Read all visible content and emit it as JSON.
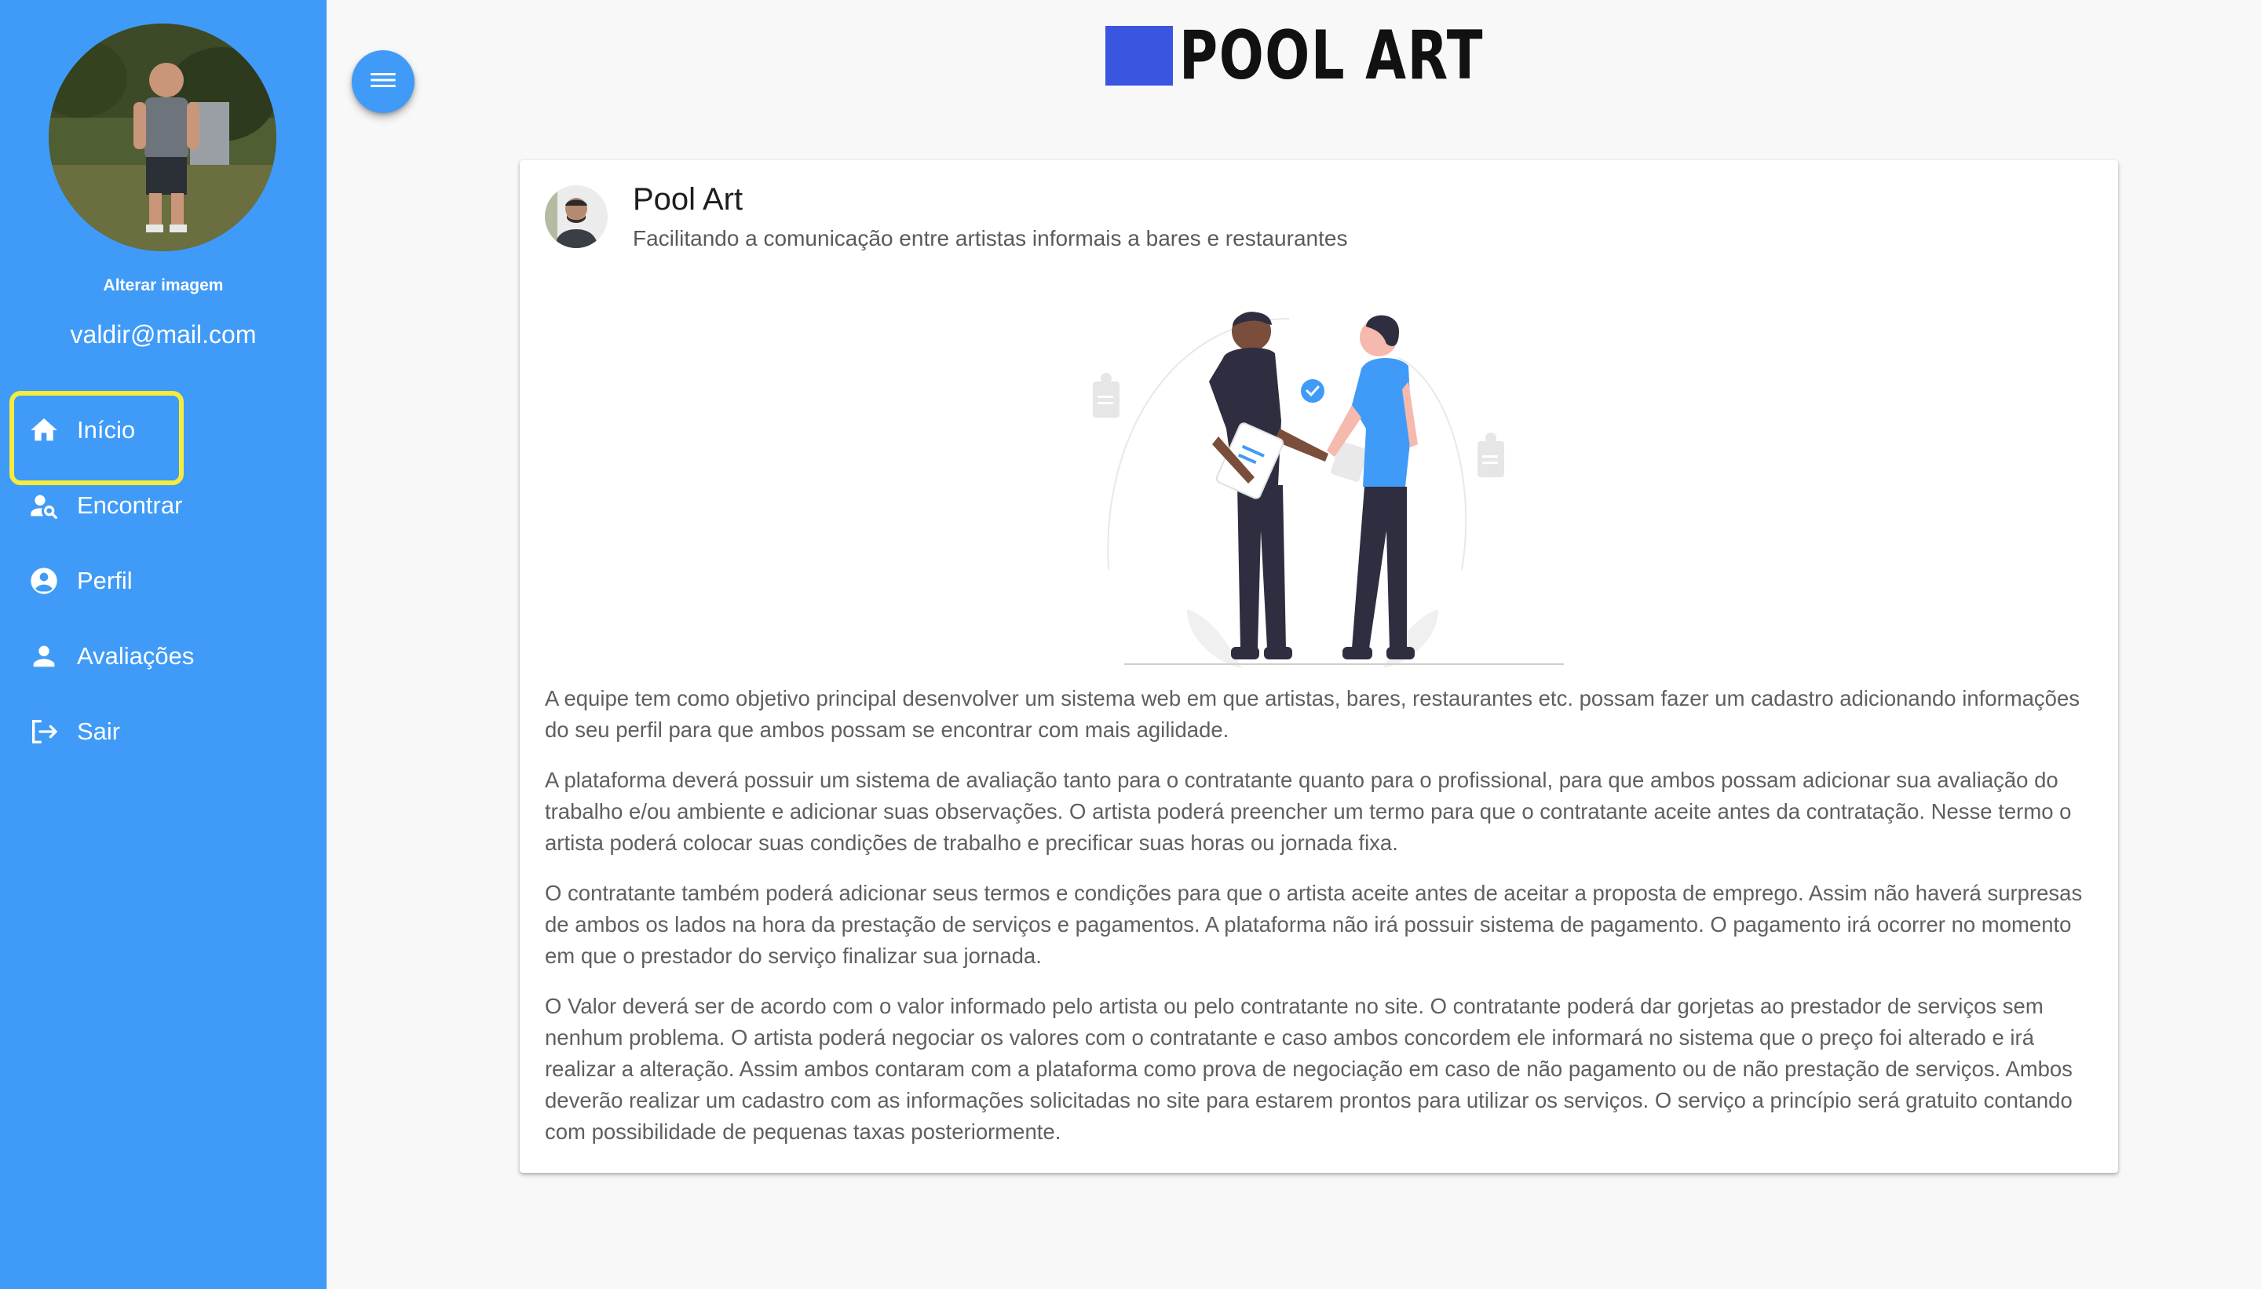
{
  "app": {
    "logo_text": "POOL ART"
  },
  "sidebar": {
    "change_image_label": "Alterar imagem",
    "email": "valdir@mail.com",
    "items": [
      {
        "label": "Início",
        "icon": "home-icon",
        "active": true
      },
      {
        "label": "Encontrar",
        "icon": "person-search-icon",
        "active": false
      },
      {
        "label": "Perfil",
        "icon": "account-circle-icon",
        "active": false
      },
      {
        "label": "Avaliações",
        "icon": "person-icon",
        "active": false
      },
      {
        "label": "Sair",
        "icon": "logout-icon",
        "active": false
      }
    ]
  },
  "card": {
    "title": "Pool Art",
    "subtitle": "Facilitando a comunicação entre artistas informais a bares e restaurantes",
    "paragraphs": [
      "A equipe tem como objetivo principal desenvolver um sistema web em que artistas, bares, restaurantes etc. possam fazer um cadastro adicionando informações do seu perfil para que ambos possam se encontrar com mais agilidade.",
      "A plataforma deverá possuir um sistema de avaliação tanto para o contratante quanto para o profissional, para que ambos possam adicionar sua avaliação do trabalho e/ou ambiente e adicionar suas observações. O artista poderá preencher um termo para que o contratante aceite antes da contratação. Nesse termo o artista poderá colocar suas condições de trabalho e precificar suas horas ou jornada fixa.",
      "O contratante também poderá adicionar seus termos e condições para que o artista aceite antes de aceitar a proposta de emprego. Assim não haverá surpresas de ambos os lados na hora da prestação de serviços e pagamentos. A plataforma não irá possuir sistema de pagamento. O pagamento irá ocorrer no momento em que o prestador do serviço finalizar sua jornada.",
      "O Valor deverá ser de acordo com o valor informado pelo artista ou pelo contratante no site. O contratante poderá dar gorjetas ao prestador de serviços sem nenhum problema. O artista poderá negociar os valores com o contratante e caso ambos concordem ele informará no sistema que o preço foi alterado e irá realizar a alteração. Assim ambos contaram com a plataforma como prova de negociação em caso de não pagamento ou de não prestação de serviços. Ambos deverão realizar um cadastro com as informações solicitadas no site para estarem prontos para utilizar os serviços. O serviço a princípio será gratuito contando com possibilidade de pequenas taxas posteriormente."
    ]
  },
  "colors": {
    "sidebar": "#3f9bf7",
    "active_outline": "#f5ec3c",
    "logo_square": "#3a55e0",
    "illustration_accent": "#3f9bf7"
  }
}
